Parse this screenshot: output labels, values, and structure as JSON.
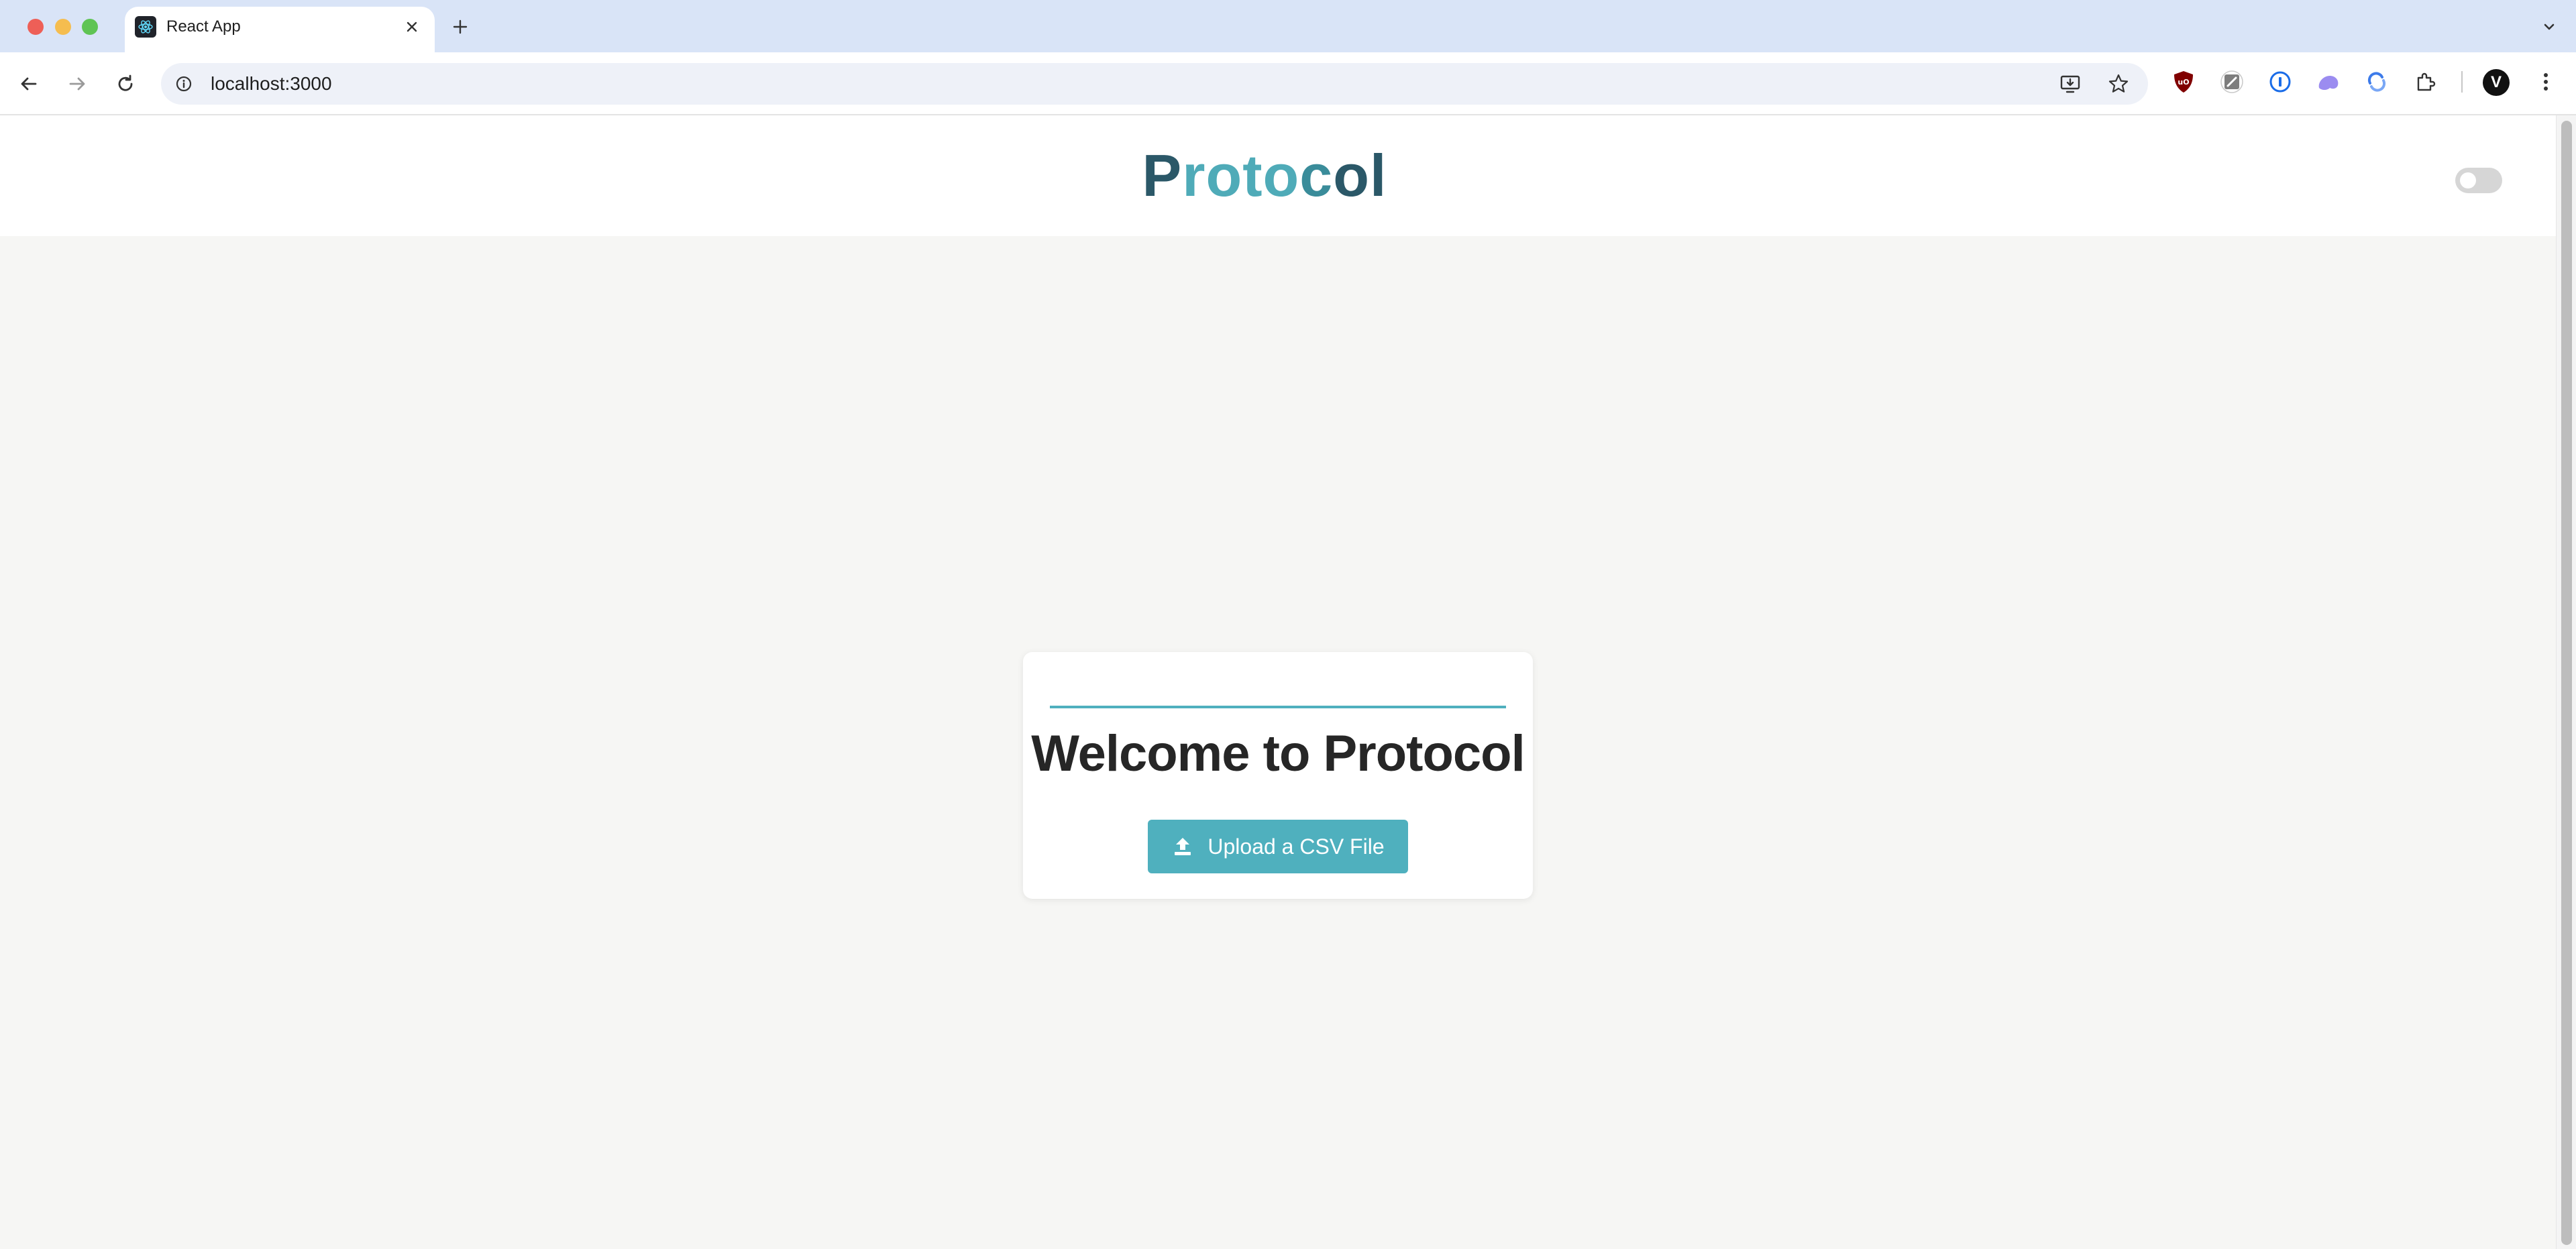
{
  "browser": {
    "tab_title": "React App",
    "url": "localhost:3000",
    "profile_initial": "V"
  },
  "app": {
    "brand_parts": [
      "P",
      "roto",
      "c",
      "ol"
    ],
    "dark_mode_enabled": false
  },
  "welcome_card": {
    "title": "Welcome to Protocol",
    "upload_label": "Upload a CSV File"
  },
  "colors": {
    "accent": "#4fb0be",
    "brand_dark": "#2b5868",
    "page_background": "#f6f6f4"
  }
}
